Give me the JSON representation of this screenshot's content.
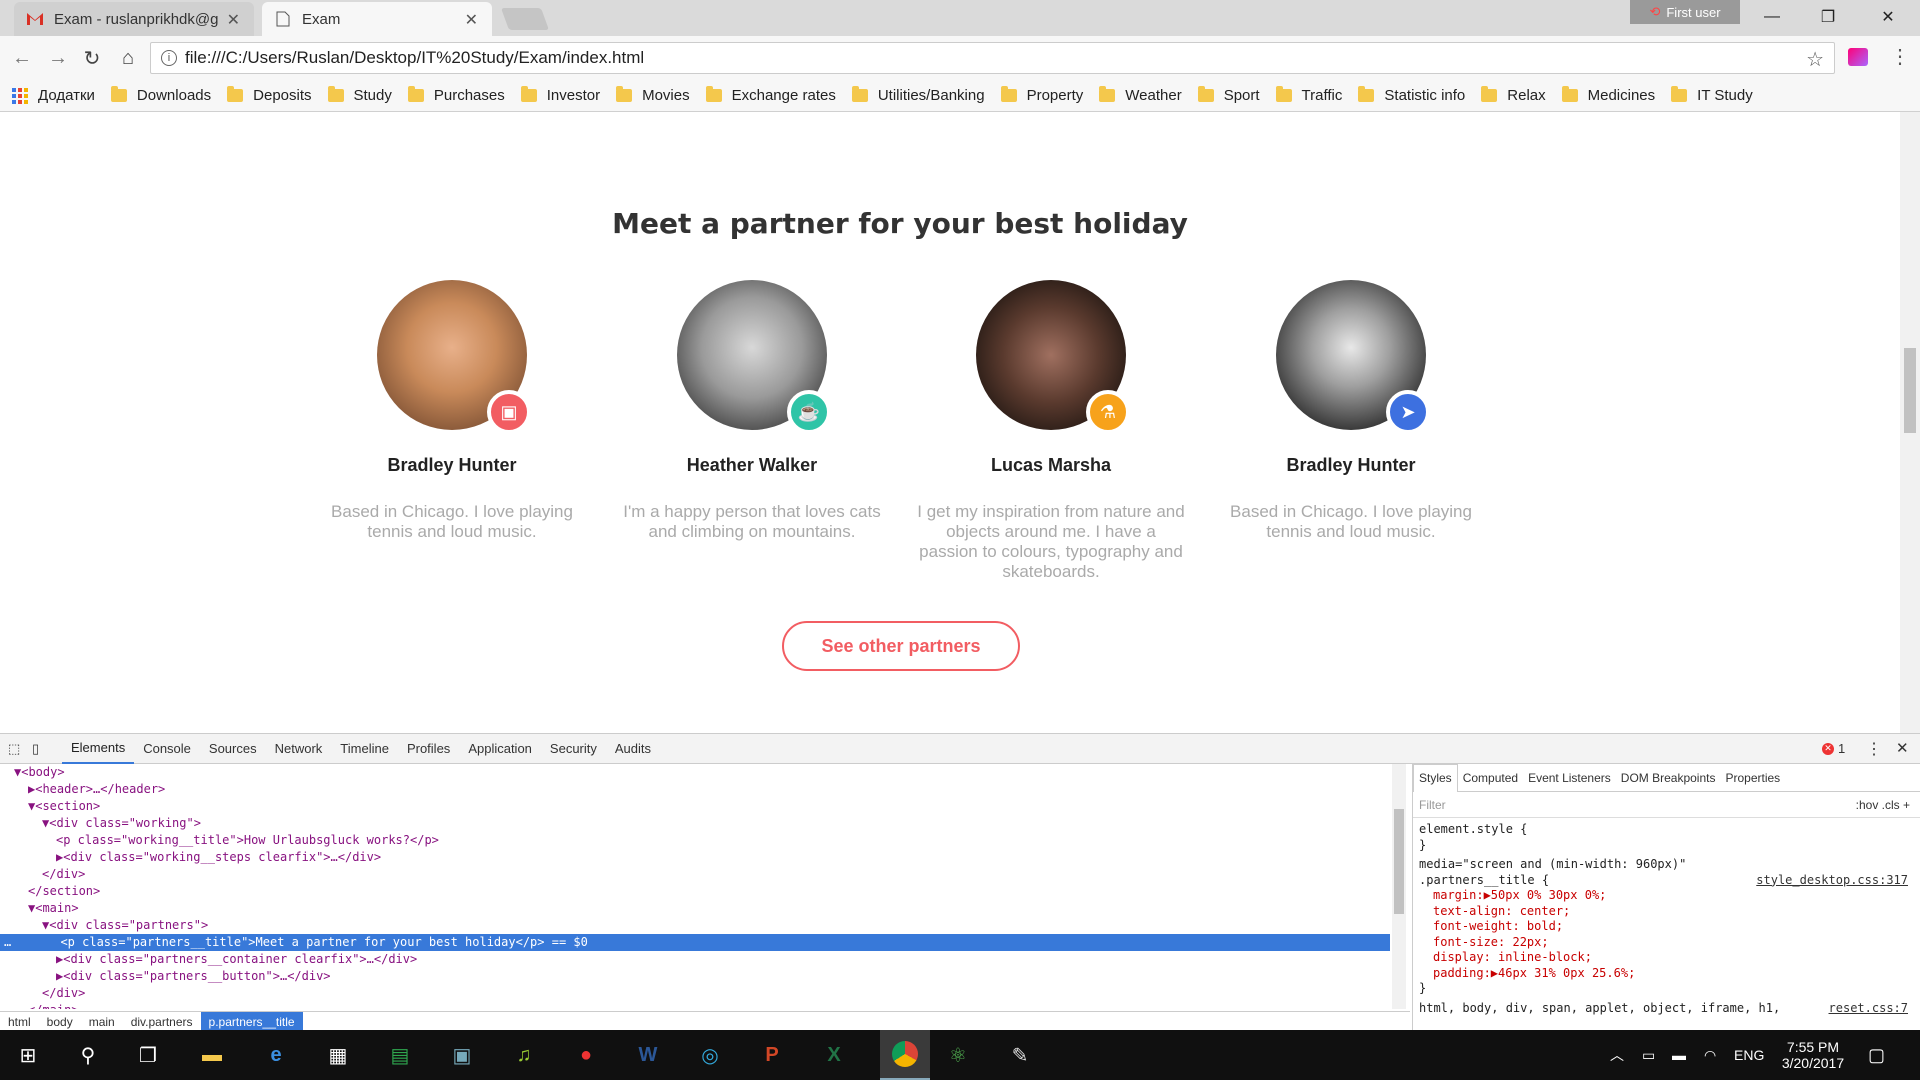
{
  "browser": {
    "tabs": [
      {
        "label": "Exam - ruslanprikhdk@g",
        "icon": "gmail-icon"
      },
      {
        "label": "Exam",
        "icon": "page-icon"
      }
    ],
    "profile": "First user",
    "url": "file:///C:/Users/Ruslan/Desktop/IT%20Study/Exam/index.html",
    "bookmarks": [
      "Додатки",
      "Downloads",
      "Deposits",
      "Study",
      "Purchases",
      "Investor",
      "Movies",
      "Exchange rates",
      "Utilities/Banking",
      "Property",
      "Weather",
      "Sport",
      "Traffic",
      "Statistic info",
      "Relax",
      "Medicines",
      "IT Study"
    ]
  },
  "page": {
    "title": "Meet a partner for your best holiday",
    "partners": [
      {
        "name": "Bradley Hunter",
        "desc": "Based in Chicago. I love playing tennis and loud music.",
        "badge_color": "#f25d62",
        "badge_icon": "tv-icon"
      },
      {
        "name": "Heather Walker",
        "desc": "I'm a happy person that loves cats and climbing on mountains.",
        "badge_color": "#2fc4a7",
        "badge_icon": "cup-icon"
      },
      {
        "name": "Lucas Marsha",
        "desc": "I get my inspiration from nature and objects around me. I have a passion to colours, typography and skateboards.",
        "badge_color": "#f7a21b",
        "badge_icon": "flask-icon"
      },
      {
        "name": "Bradley Hunter",
        "desc": "Based in Chicago. I love playing tennis and loud music.",
        "badge_color": "#3d70e0",
        "badge_icon": "plane-icon"
      }
    ],
    "button": "See other partners",
    "accent": "#f25d62"
  },
  "devtools": {
    "tabs": [
      "Elements",
      "Console",
      "Sources",
      "Network",
      "Timeline",
      "Profiles",
      "Application",
      "Security",
      "Audits"
    ],
    "error_count": "1",
    "dom": [
      {
        "t": "▼<body>",
        "d": 0
      },
      {
        "t": "▶<header>…</header>",
        "d": 1
      },
      {
        "t": "▼<section>",
        "d": 1
      },
      {
        "t": "▼<div class=\"working\">",
        "d": 2
      },
      {
        "t": "<p class=\"working__title\">How Urlaubsgluck works?</p>",
        "d": 3
      },
      {
        "t": "▶<div class=\"working__steps clearfix\">…</div>",
        "d": 3
      },
      {
        "t": "</div>",
        "d": 2
      },
      {
        "t": "</section>",
        "d": 1
      },
      {
        "t": "▼<main>",
        "d": 1
      },
      {
        "t": "▼<div class=\"partners\">",
        "d": 2
      },
      {
        "t": "<p class=\"partners__title\">Meet a partner for your best holiday</p> == $0",
        "d": 3,
        "sel": true
      },
      {
        "t": "▶<div class=\"partners__container clearfix\">…</div>",
        "d": 3
      },
      {
        "t": "▶<div class=\"partners__button\">…</div>",
        "d": 3
      },
      {
        "t": "</div>",
        "d": 2
      },
      {
        "t": "</main>",
        "d": 1
      }
    ],
    "crumbs": [
      "html",
      "body",
      "main",
      "div.partners",
      "p.partners__title"
    ],
    "style_tabs": [
      "Styles",
      "Computed",
      "Event Listeners",
      "DOM Breakpoints",
      "Properties"
    ],
    "filter_placeholder": "Filter",
    "filter_right": ":hov  .cls  +",
    "styles": [
      "element.style {",
      "}",
      "media=\"screen and (min-width: 960px)\"",
      ".partners__title {",
      "  margin:▶50px 0% 30px 0%;",
      "  text-align: center;",
      "  font-weight: bold;",
      "  font-size: 22px;",
      "  display: inline-block;",
      "  padding:▶46px 31% 0px 25.6%;",
      "}",
      "html, body, div, span, applet, object, iframe, h1,"
    ],
    "style_link": "style_desktop.css:317",
    "reset_link": "reset.css:7"
  },
  "taskbar": {
    "lang": "ENG",
    "time": "7:55 PM",
    "date": "3/20/2017"
  }
}
